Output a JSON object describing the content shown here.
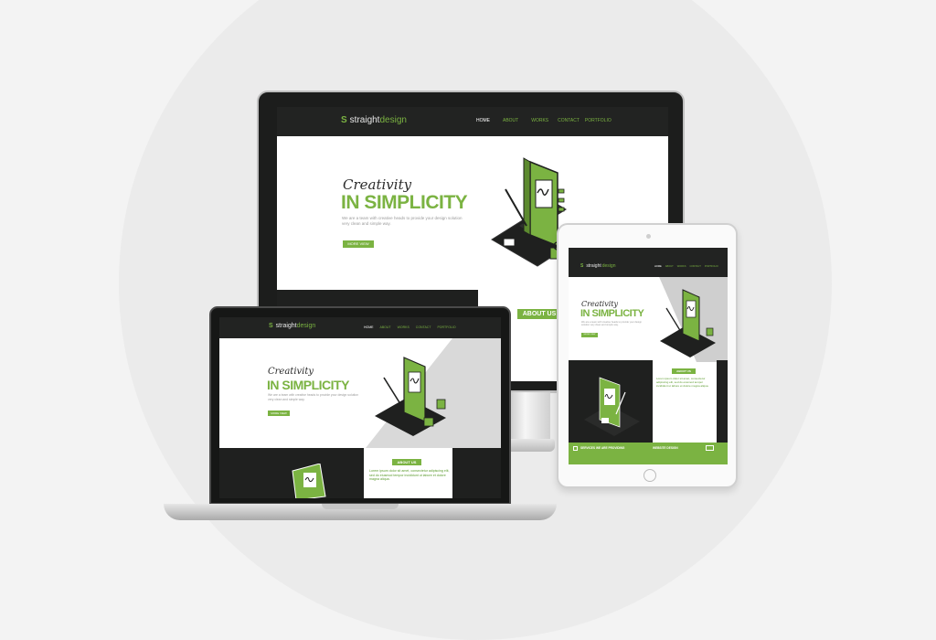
{
  "site": {
    "logo_part1": "straight",
    "logo_part2": "design",
    "logo_mark": "S",
    "nav": [
      "HOME",
      "ABOUT",
      "WORKS",
      "CONTACT",
      "PORTFOLIO"
    ],
    "hero_script": "Creativity",
    "hero_headline": "IN SIMPLICITY",
    "hero_text": "We are a team with creative heads to provide your design solution very clean and simple way.",
    "hero_button": "MORE VIEW",
    "about_label": "ABOUT US",
    "about_text": "Lorem ipsum dolor sit amet, consectetur adipiscing elit, sed do eiusmod tempor incididunt ut labore et dolore magna aliqua.",
    "services_label": "SERVICES WE ARE PROVIDING",
    "service_item": "WEBSITE DESIGN"
  },
  "colors": {
    "brand_green": "#7bb342",
    "dark": "#1f201f",
    "nav_bg": "#222322"
  },
  "icons": {
    "logo": "s-logo-icon",
    "check": "checkbox-icon",
    "monitor_small": "monitor-icon",
    "illustration": "laptop-signature-illustration"
  }
}
